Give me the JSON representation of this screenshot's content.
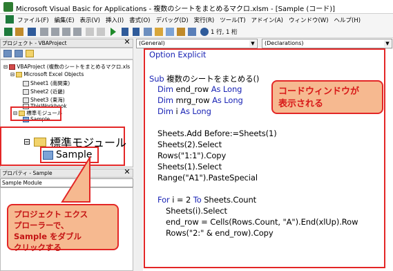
{
  "window": {
    "title": "Microsoft Visual Basic for Applications - 複数のシートをまとめるマクロ.xlsm - [Sample (コード)]"
  },
  "menu": [
    "ファイル(F)",
    "編集(E)",
    "表示(V)",
    "挿入(I)",
    "書式(O)",
    "デバッグ(D)",
    "実行(R)",
    "ツール(T)",
    "アドイン(A)",
    "ウィンドウ(W)",
    "ヘルプ(H)"
  ],
  "toolbar": {
    "cursor_pos": "1 行, 1 桁"
  },
  "project": {
    "title": "プロジェクト - VBAProject",
    "root": "VBAProject (複数のシートをまとめるマクロ.xls",
    "excel_objects": "Microsoft Excel Objects",
    "sheets": [
      "Sheet1 (南関東)",
      "Sheet2 (近畿)",
      "Sheet3 (東海)",
      "ThisWorkbook"
    ],
    "std_module": "標準モジュール",
    "sample": "Sample"
  },
  "zoom": {
    "std_module": "標準モジュール",
    "sample": "Sample"
  },
  "properties": {
    "title": "プロパティ - Sample",
    "select": "Sample Module"
  },
  "code": {
    "general": "(General)",
    "declarations": "(Declarations)",
    "lines": [
      {
        "kw": "Option Explicit",
        "text": ""
      },
      {
        "kw": "Sub",
        "text": " 複数のシートをまとめる()"
      },
      {
        "kw": "Dim",
        "text": " end_row ",
        "kw2": "As Long"
      },
      {
        "kw": "Dim",
        "text": " mrg_row ",
        "kw2": "As Long"
      },
      {
        "kw": "Dim",
        "text": " i ",
        "kw2": "As Long"
      },
      {
        "text": "Sheets.Add Before:=Sheets(1)"
      },
      {
        "text": "Sheets(2).Select"
      },
      {
        "text": "Rows(\"1:1\").Copy"
      },
      {
        "text": "Sheets(1).Select"
      },
      {
        "text": "Range(\"A1\").PasteSpecial"
      },
      {
        "kw": "For",
        "text": " i = 2 ",
        "kw2": "To",
        "text2": " Sheets.Count"
      },
      {
        "text": "Sheets(i).Select"
      },
      {
        "text": "end_row = Cells(Rows.Count, \"A\").End(xlUp).Row"
      },
      {
        "text": "Rows(\"2:\" & end_row).Copy"
      }
    ]
  },
  "callouts": {
    "code_window": [
      "コードウィンドウが",
      "表示される"
    ],
    "project_explorer": [
      "プロジェクト エクス",
      "プローラーで、",
      "Sample をダブル",
      "クリックする"
    ]
  },
  "colors": {
    "keyword": "#1a24b5",
    "highlight": "#e32626",
    "callout_bg": "#f6b990"
  }
}
